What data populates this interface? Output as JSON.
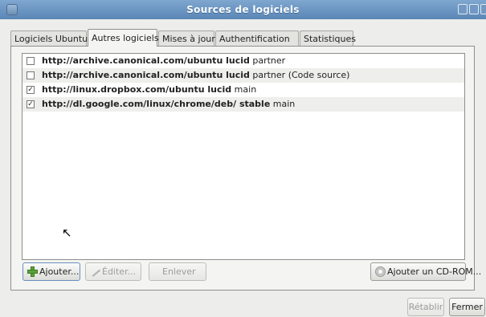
{
  "window": {
    "title": "Sources de logiciels"
  },
  "tabs": [
    {
      "label": "Logiciels Ubuntu"
    },
    {
      "label": "Autres logiciels"
    },
    {
      "label": "Mises à jour"
    },
    {
      "label": "Authentification"
    },
    {
      "label": "Statistiques"
    }
  ],
  "sources": [
    {
      "checked": false,
      "url": "http://archive.canonical.com/ubuntu lucid",
      "component": " partner"
    },
    {
      "checked": false,
      "url": "http://archive.canonical.com/ubuntu lucid",
      "component": " partner (Code source)"
    },
    {
      "checked": true,
      "url": "http://linux.dropbox.com/ubuntu lucid",
      "component": " main"
    },
    {
      "checked": true,
      "url": "http://dl.google.com/linux/chrome/deb/ stable",
      "component": " main"
    }
  ],
  "buttons": {
    "add": "Ajouter...",
    "edit": "Éditer...",
    "remove": "Enlever",
    "add_cdrom": "Ajouter un CD-ROM...",
    "restore": "Rétablir",
    "close": "Fermer"
  },
  "icons": {
    "add": "plus-icon",
    "edit": "pencil-icon",
    "cdrom": "cd-icon",
    "check": "✓"
  }
}
